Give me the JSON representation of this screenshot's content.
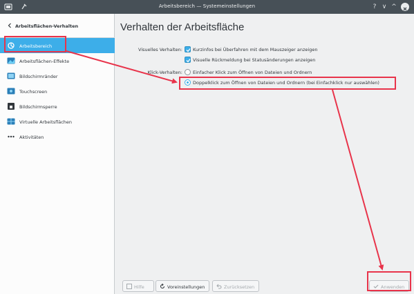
{
  "window": {
    "title": "Arbeitsbereich — Systemeinstellungen",
    "minimize_glyph": "?",
    "help_glyph": "∨",
    "restore_glyph": "^"
  },
  "sidebar": {
    "back_label": "Arbeitsflächen-Verhalten",
    "items": [
      {
        "label": "Arbeitsbereich",
        "icon": "workspace-icon"
      },
      {
        "label": "Arbeitsflächen-Effekte",
        "icon": "desktop-effects-icon"
      },
      {
        "label": "Bildschirmränder",
        "icon": "screen-edges-icon"
      },
      {
        "label": "Touchscreen",
        "icon": "touchscreen-icon"
      },
      {
        "label": "Bildschirmsperre",
        "icon": "screen-lock-icon"
      },
      {
        "label": "Virtuelle Arbeitsflächen",
        "icon": "virtual-desktops-icon"
      },
      {
        "label": "Aktivitäten",
        "icon": "activities-icon"
      }
    ]
  },
  "main": {
    "heading": "Verhalten der Arbeitsfläche",
    "visual_label": "Visuelles Verhalten:",
    "visual_options": [
      {
        "text": "Kurzinfos bei Überfahren mit dem Mauszeiger anzeigen",
        "checked": true
      },
      {
        "text": "Visuelle Rückmeldung bei Statusänderungen anzeigen",
        "checked": true
      }
    ],
    "click_label": "Klick-Verhalten:",
    "click_options": [
      {
        "text": "Einfacher Klick zum Öffnen von Dateien und Ordnern",
        "selected": false
      },
      {
        "text": "Doppelklick zum Öffnen von Dateien und Ordnern (bei Einfachklick nur auswählen)",
        "selected": true
      }
    ]
  },
  "buttons": {
    "help": "Hilfe",
    "defaults": "Voreinstellungen",
    "reset": "Zurücksetzen",
    "apply": "Anwenden"
  },
  "colors": {
    "accent": "#3daee9",
    "annotation": "#e8334a",
    "titlebar": "#475057"
  }
}
